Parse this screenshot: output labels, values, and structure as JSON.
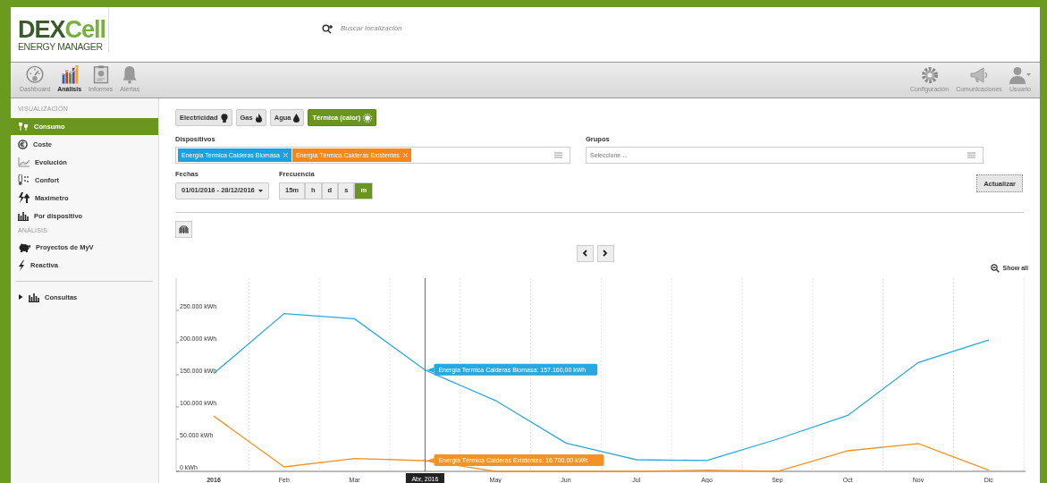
{
  "header": {
    "logo": {
      "primary": "DEX",
      "accent": "Cell",
      "subtitle": "ENERGY MANAGER"
    },
    "search": {
      "placeholder": "Buscar localización"
    }
  },
  "toolbar": {
    "left": [
      {
        "label": "Dashboard",
        "selected": false
      },
      {
        "label": "Análisis",
        "selected": true
      },
      {
        "label": "Informes",
        "selected": false
      },
      {
        "label": "Alertas",
        "selected": false
      }
    ],
    "right": [
      {
        "label": "Configuración",
        "selected": false
      },
      {
        "label": "Comunicaciones",
        "selected": false
      },
      {
        "label": "Usuario",
        "selected": false
      }
    ]
  },
  "sidebar": {
    "sections": [
      {
        "title": "VISUALIZACIÓN",
        "items": [
          {
            "label": "Consumo",
            "selected": true
          },
          {
            "label": "Coste",
            "selected": false
          },
          {
            "label": "Evolución",
            "selected": false
          },
          {
            "label": "Confort",
            "selected": false
          },
          {
            "label": "Maximetro",
            "selected": false
          },
          {
            "label": "Por dispositivo",
            "selected": false
          }
        ]
      },
      {
        "title": "ANÁLISIS",
        "items": [
          {
            "label": "Proyectos de MyV",
            "selected": false
          },
          {
            "label": "Reactiva",
            "selected": false
          }
        ]
      }
    ],
    "tree": [
      {
        "label": "Consultas",
        "expanded": false
      }
    ]
  },
  "filters": {
    "energy_types": [
      {
        "label": "Electricidad",
        "selected": false
      },
      {
        "label": "Gas",
        "selected": false
      },
      {
        "label": "Agua",
        "selected": false
      },
      {
        "label": "Térmica (calor)",
        "selected": true
      }
    ],
    "devices": {
      "label": "Dispositivos",
      "tags": [
        {
          "label": "Energía Termica Calderas Biomasa",
          "color": "#1ba1e2"
        },
        {
          "label": "Energía Térmica Calderas Existentes",
          "color": "#f7861b"
        }
      ]
    },
    "groups": {
      "label": "Grupos",
      "placeholder": "Seleccione ..."
    },
    "dates": {
      "label": "Fechas",
      "value": "01/01/2016 - 28/12/2016"
    },
    "frequency": {
      "label": "Frecuencia",
      "options": [
        {
          "label": "15m",
          "selected": false
        },
        {
          "label": "h",
          "selected": false
        },
        {
          "label": "d",
          "selected": false
        },
        {
          "label": "s",
          "selected": false
        },
        {
          "label": "m",
          "selected": true
        }
      ]
    },
    "update_button": "Actualizar"
  },
  "chart": {
    "show_all": "Show all",
    "chart_data": {
      "type": "line",
      "categories": [
        "2016",
        "Feb",
        "Mar",
        "Abr, 2016",
        "May",
        "Jun",
        "Jul",
        "Ago",
        "Sep",
        "Oct",
        "Nov",
        "Dic"
      ],
      "ylim": [
        0,
        300000
      ],
      "yticks": [
        {
          "value": 0,
          "label": "0 kWh"
        },
        {
          "value": 50000,
          "label": "50.000 kWh"
        },
        {
          "value": 100000,
          "label": "100.000 kWh"
        },
        {
          "value": 150000,
          "label": "150.000 kWh"
        },
        {
          "value": 200000,
          "label": "200.000 kWh"
        },
        {
          "value": 250000,
          "label": "250.000 kWh"
        }
      ],
      "series": [
        {
          "color": "#29a8e0",
          "values": [
            152000,
            245000,
            237000,
            157160,
            110000,
            44000,
            18000,
            17000,
            50000,
            87000,
            169000,
            204000
          ]
        },
        {
          "color": "#f39325",
          "values": [
            86000,
            7000,
            20000,
            16700,
            0,
            0,
            0,
            2000,
            0,
            32000,
            43000,
            2000
          ]
        }
      ],
      "ref_lines": [
        {
          "axis": "x",
          "value": "Abr, 2016"
        }
      ],
      "annotations": [
        {
          "x": "Abr, 2016",
          "y": 157160,
          "text": "Energía Termica Calderas Biomasa: 157.160,00 kWh"
        },
        {
          "x": "Abr, 2016",
          "y": 16700,
          "text": "Energía Térmica Calderas Existentes: 16.700,00 kWh"
        }
      ]
    }
  }
}
